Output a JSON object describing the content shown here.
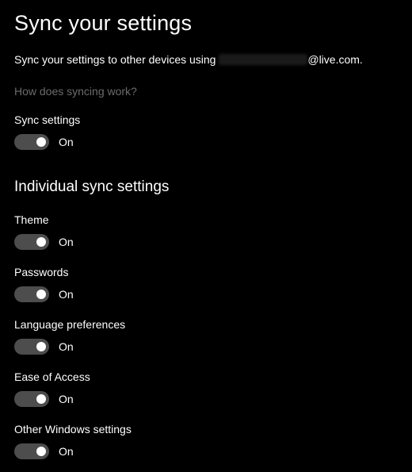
{
  "title": "Sync your settings",
  "desc_prefix": "Sync your settings to other devices using ",
  "desc_suffix": "@live.com.",
  "link_text": "How does syncing work?",
  "main_toggle": {
    "label": "Sync settings",
    "status": "On"
  },
  "section_heading": "Individual sync settings",
  "items": [
    {
      "label": "Theme",
      "status": "On"
    },
    {
      "label": "Passwords",
      "status": "On"
    },
    {
      "label": "Language preferences",
      "status": "On"
    },
    {
      "label": "Ease of Access",
      "status": "On"
    },
    {
      "label": "Other Windows settings",
      "status": "On"
    }
  ]
}
